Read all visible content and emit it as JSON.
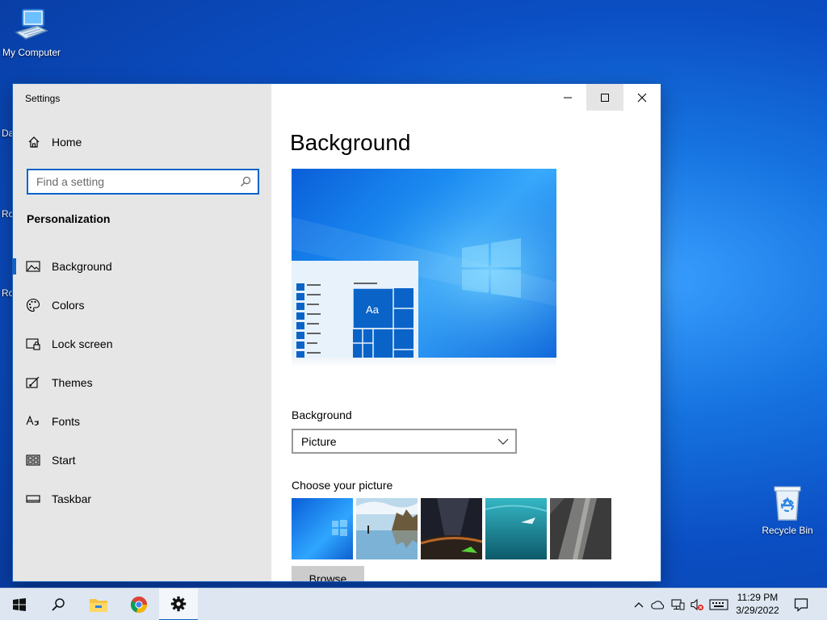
{
  "desktop": {
    "icons": [
      {
        "label": "My Computer",
        "icon": "computer-icon"
      },
      {
        "label": "Recycle Bin",
        "icon": "recycle-bin-icon"
      }
    ],
    "edge_fragments": [
      "Da",
      "Ro",
      "Ro"
    ]
  },
  "window": {
    "title": "Settings",
    "home_label": "Home",
    "search": {
      "placeholder": "Find a setting",
      "value": ""
    },
    "section": "Personalization",
    "nav": [
      {
        "label": "Background",
        "icon": "background-icon",
        "active": true
      },
      {
        "label": "Colors",
        "icon": "palette-icon",
        "active": false
      },
      {
        "label": "Lock screen",
        "icon": "lock-screen-icon",
        "active": false
      },
      {
        "label": "Themes",
        "icon": "themes-icon",
        "active": false
      },
      {
        "label": "Fonts",
        "icon": "fonts-icon",
        "active": false
      },
      {
        "label": "Start",
        "icon": "start-icon",
        "active": false
      },
      {
        "label": "Taskbar",
        "icon": "taskbar-icon",
        "active": false
      }
    ],
    "main": {
      "title": "Background",
      "preview_tile_text": "Aa",
      "background_label": "Background",
      "background_value": "Picture",
      "choose_label": "Choose your picture",
      "browse_label": "Browse"
    }
  },
  "taskbar": {
    "apps": [
      "start-icon",
      "search-icon",
      "file-explorer-icon",
      "chrome-icon",
      "settings-icon"
    ],
    "active_app": "settings-icon",
    "tray": [
      "chevron-up-icon",
      "onedrive-icon",
      "network-icon",
      "volume-muted-icon",
      "keyboard-icon"
    ],
    "time": "11:29 PM",
    "date": "3/29/2022",
    "notification_icon": "notification-icon"
  },
  "colors": {
    "accent": "#0a64c8",
    "sidebar": "#e6e6e6",
    "taskbar": "#dde6f1"
  }
}
